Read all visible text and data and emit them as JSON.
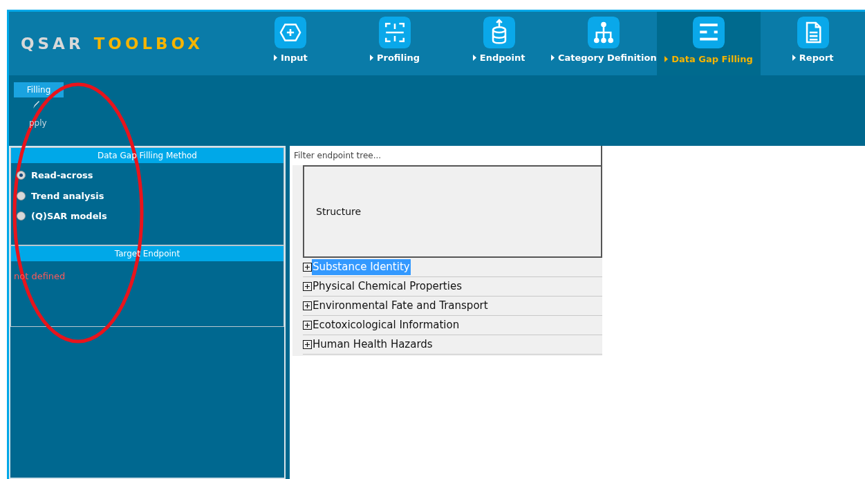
{
  "logo": {
    "first": "QSAR",
    "second": "TOOLBOX"
  },
  "tabs": [
    {
      "label": "Input",
      "selected": false
    },
    {
      "label": "Profiling",
      "selected": false
    },
    {
      "label": "Endpoint",
      "selected": false
    },
    {
      "label": "Category Definition",
      "selected": false
    },
    {
      "label": "Data Gap Filling",
      "selected": true
    },
    {
      "label": "Report",
      "selected": false
    }
  ],
  "ribbon": {
    "group": "Filling",
    "action": "pply"
  },
  "method_panel": {
    "title": "Data Gap Filling Method",
    "options": [
      {
        "label": "Read-across",
        "selected": true
      },
      {
        "label": "Trend analysis",
        "selected": false
      },
      {
        "label": "(Q)SAR models",
        "selected": false
      }
    ]
  },
  "target_panel": {
    "title": "Target Endpoint",
    "value": "not defined"
  },
  "filter": {
    "placeholder": "Filter endpoint tree..."
  },
  "structure": {
    "label": "Structure"
  },
  "tree": [
    {
      "label": "Substance Identity",
      "selected": true,
      "expanded": false
    },
    {
      "label": "Physical Chemical Properties",
      "selected": false,
      "expanded": false
    },
    {
      "label": "Environmental Fate and Transport",
      "selected": false,
      "expanded": false
    },
    {
      "label": "Ecotoxicological Information",
      "selected": false,
      "expanded": false
    },
    {
      "label": "Human Health Hazards",
      "selected": false,
      "expanded": false
    }
  ]
}
